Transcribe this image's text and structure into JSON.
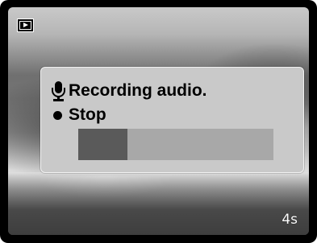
{
  "screen": {
    "mode_icon": "playback-mode-icon"
  },
  "dialog": {
    "recording_icon": "microphone-icon",
    "recording_label": "Recording audio.",
    "stop_icon": "record-dot-icon",
    "stop_label": "Stop",
    "progress_fraction": 0.25
  },
  "status": {
    "time_remaining": "4s"
  },
  "colors": {
    "dialog_background": "#c9c9c9",
    "progress_track": "#a8a8a8",
    "progress_fill": "#5a5a5a"
  }
}
